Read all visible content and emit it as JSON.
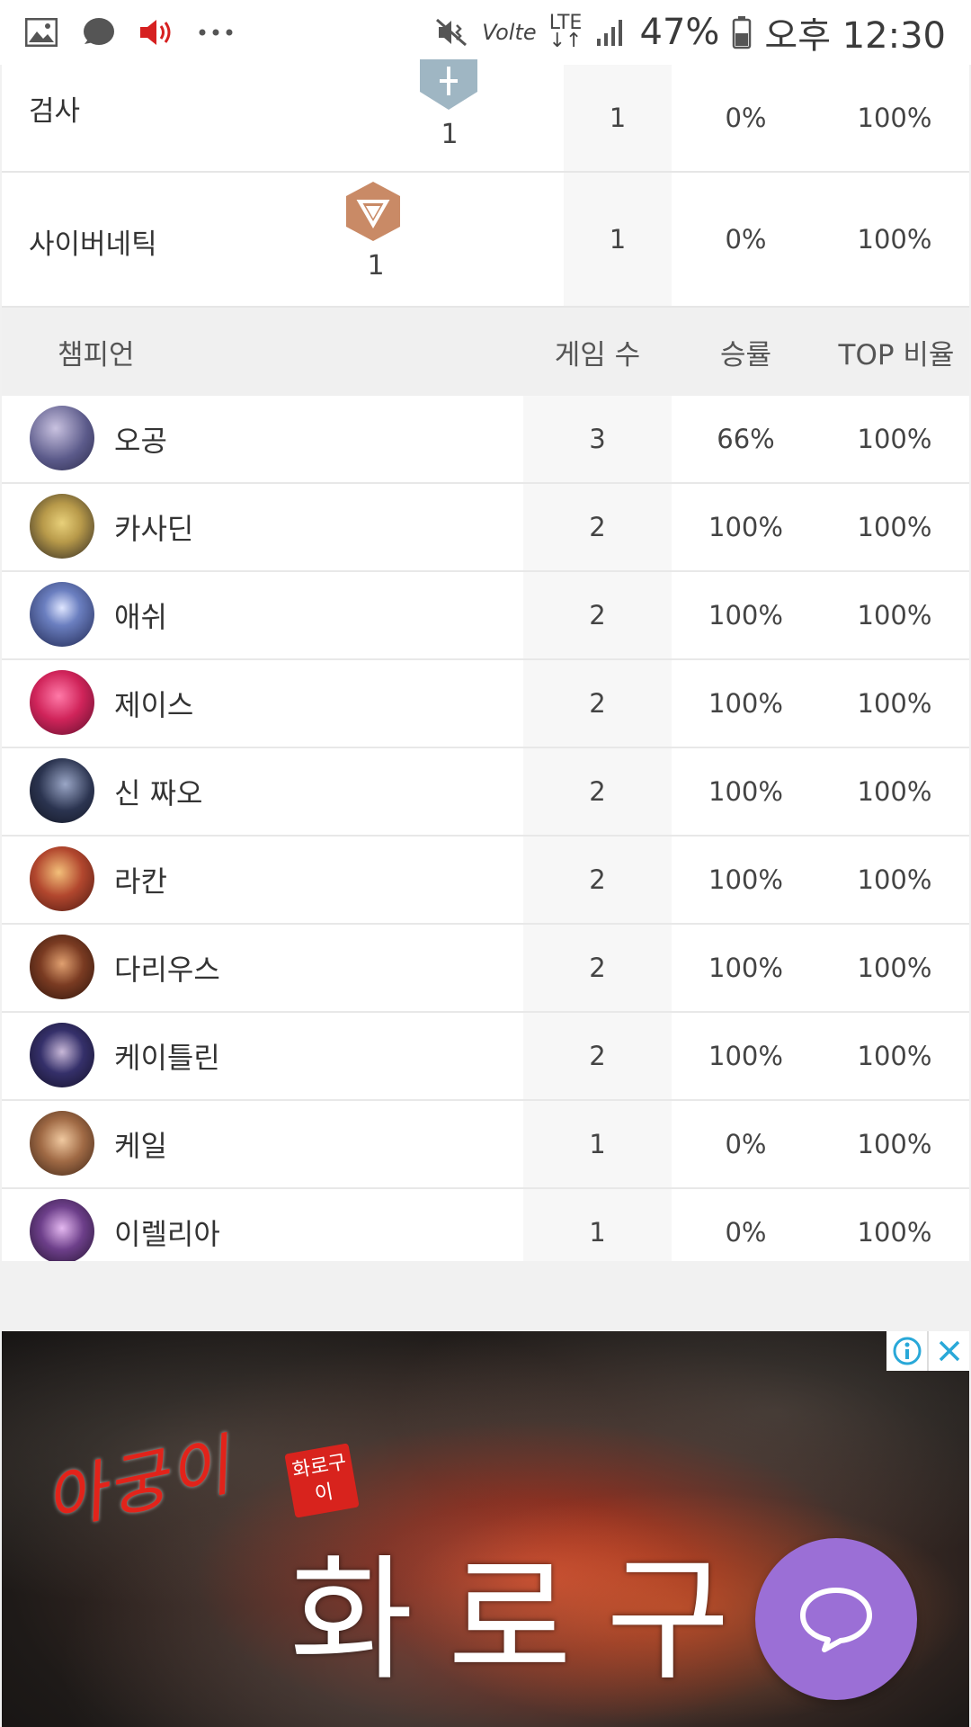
{
  "status_bar": {
    "battery": "47%",
    "time": "오후 12:30",
    "volte": "Volte",
    "lte": "LTE",
    "icons": [
      "gallery-icon",
      "chat-bubble-icon",
      "speaker-icon",
      "more-dots-icon",
      "mute-vibrate-icon",
      "volte-icon",
      "lte-arrows-icon",
      "signal-icon",
      "battery-icon"
    ]
  },
  "traits": [
    {
      "name": "검사",
      "badge_count": "1",
      "games": "1",
      "winrate": "0%",
      "top": "100%",
      "badge_icon": "sword-badge-icon",
      "badge_color": "#9fb6c3"
    },
    {
      "name": "사이버네틱",
      "badge_count": "1",
      "games": "1",
      "winrate": "0%",
      "top": "100%",
      "badge_icon": "cybernetic-badge-icon",
      "badge_color": "#c98a66"
    }
  ],
  "champion_header": {
    "name": "챔피언",
    "games": "게임 수",
    "winrate": "승률",
    "top": "TOP 비율"
  },
  "champions": [
    {
      "name": "오공",
      "games": "3",
      "winrate": "66%",
      "top": "100%",
      "avatar_color": "#5b5a8a"
    },
    {
      "name": "카사딘",
      "games": "2",
      "winrate": "100%",
      "top": "100%",
      "avatar_color": "#b89a4a"
    },
    {
      "name": "애쉬",
      "games": "2",
      "winrate": "100%",
      "top": "100%",
      "avatar_color": "#3a4d8a"
    },
    {
      "name": "제이스",
      "games": "2",
      "winrate": "100%",
      "top": "100%",
      "avatar_color": "#d0245a"
    },
    {
      "name": "신 짜오",
      "games": "2",
      "winrate": "100%",
      "top": "100%",
      "avatar_color": "#2b3450"
    },
    {
      "name": "라칸",
      "games": "2",
      "winrate": "100%",
      "top": "100%",
      "avatar_color": "#b2472e"
    },
    {
      "name": "다리우스",
      "games": "2",
      "winrate": "100%",
      "top": "100%",
      "avatar_color": "#7a3b22"
    },
    {
      "name": "케이틀린",
      "games": "2",
      "winrate": "100%",
      "top": "100%",
      "avatar_color": "#35306a"
    },
    {
      "name": "케일",
      "games": "1",
      "winrate": "0%",
      "top": "100%",
      "avatar_color": "#a06a45"
    },
    {
      "name": "이렐리아",
      "games": "1",
      "winrate": "0%",
      "top": "100%",
      "avatar_color": "#6d3f8a"
    }
  ],
  "ad": {
    "small_title": "아궁이",
    "seal_text": "화로구이",
    "title": "화로구",
    "info_icon": "info-icon",
    "close_icon": "close-icon"
  },
  "chat_button": {
    "icon": "chat-bubble-icon",
    "color": "#9b6fd6"
  }
}
